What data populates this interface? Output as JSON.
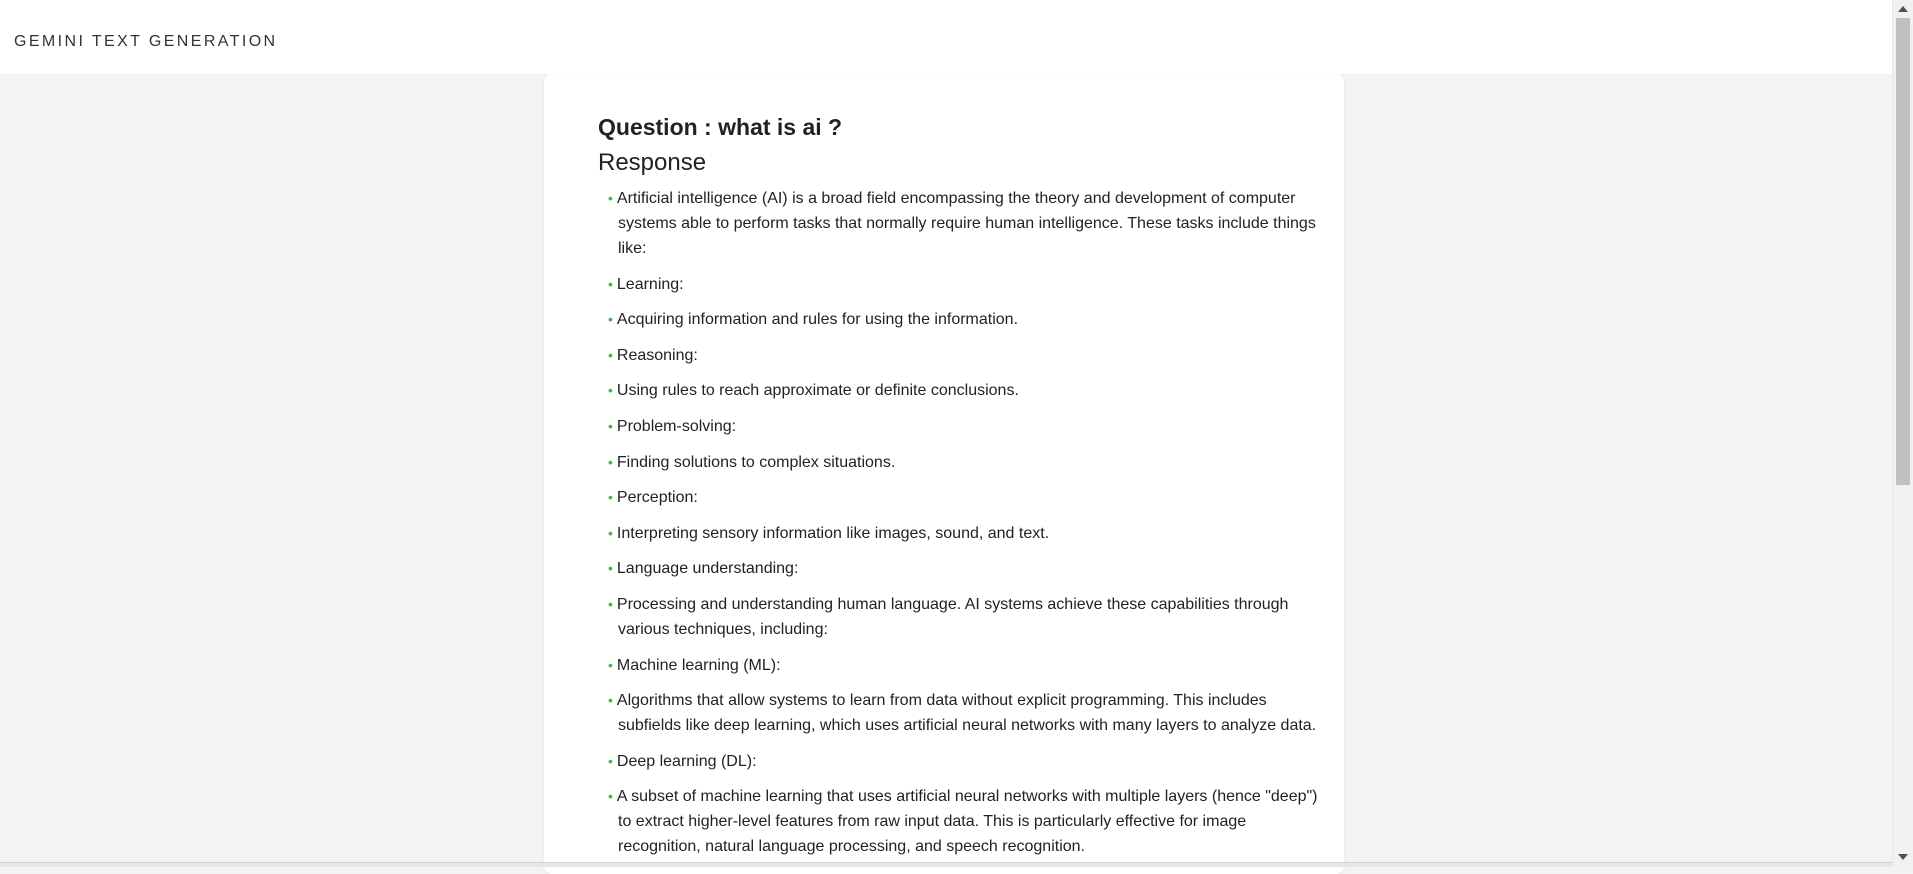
{
  "header": {
    "title": "GEMINI TEXT GENERATION"
  },
  "question": {
    "label": "Question :",
    "text": "what is ai ?"
  },
  "response": {
    "heading": "Response",
    "items": [
      "Artificial intelligence (AI) is a broad field encompassing the theory and development of computer systems able to perform tasks that normally require human intelligence. These tasks include things like:",
      "Learning:",
      "Acquiring information and rules for using the information.",
      "Reasoning:",
      "Using rules to reach approximate or definite conclusions.",
      "Problem-solving:",
      "Finding solutions to complex situations.",
      "Perception:",
      "Interpreting sensory information like images, sound, and text.",
      "Language understanding:",
      "Processing and understanding human language. AI systems achieve these capabilities through various techniques, including:",
      "Machine learning (ML):",
      "Algorithms that allow systems to learn from data without explicit programming. This includes subfields like deep learning, which uses artificial neural networks with many layers to analyze data.",
      "Deep learning (DL):",
      "A subset of machine learning that uses artificial neural networks with multiple layers (hence \"deep\") to extract higher-level features from raw input data. This is particularly effective for image recognition, natural language processing, and speech recognition."
    ]
  },
  "colors": {
    "bullet": "#4caf50",
    "page_background": "#f3f3f3",
    "card_background": "#ffffff"
  },
  "icons": {
    "bullet": "bullet-icon",
    "scroll_up": "arrow-up-icon",
    "scroll_down": "arrow-down-icon"
  }
}
